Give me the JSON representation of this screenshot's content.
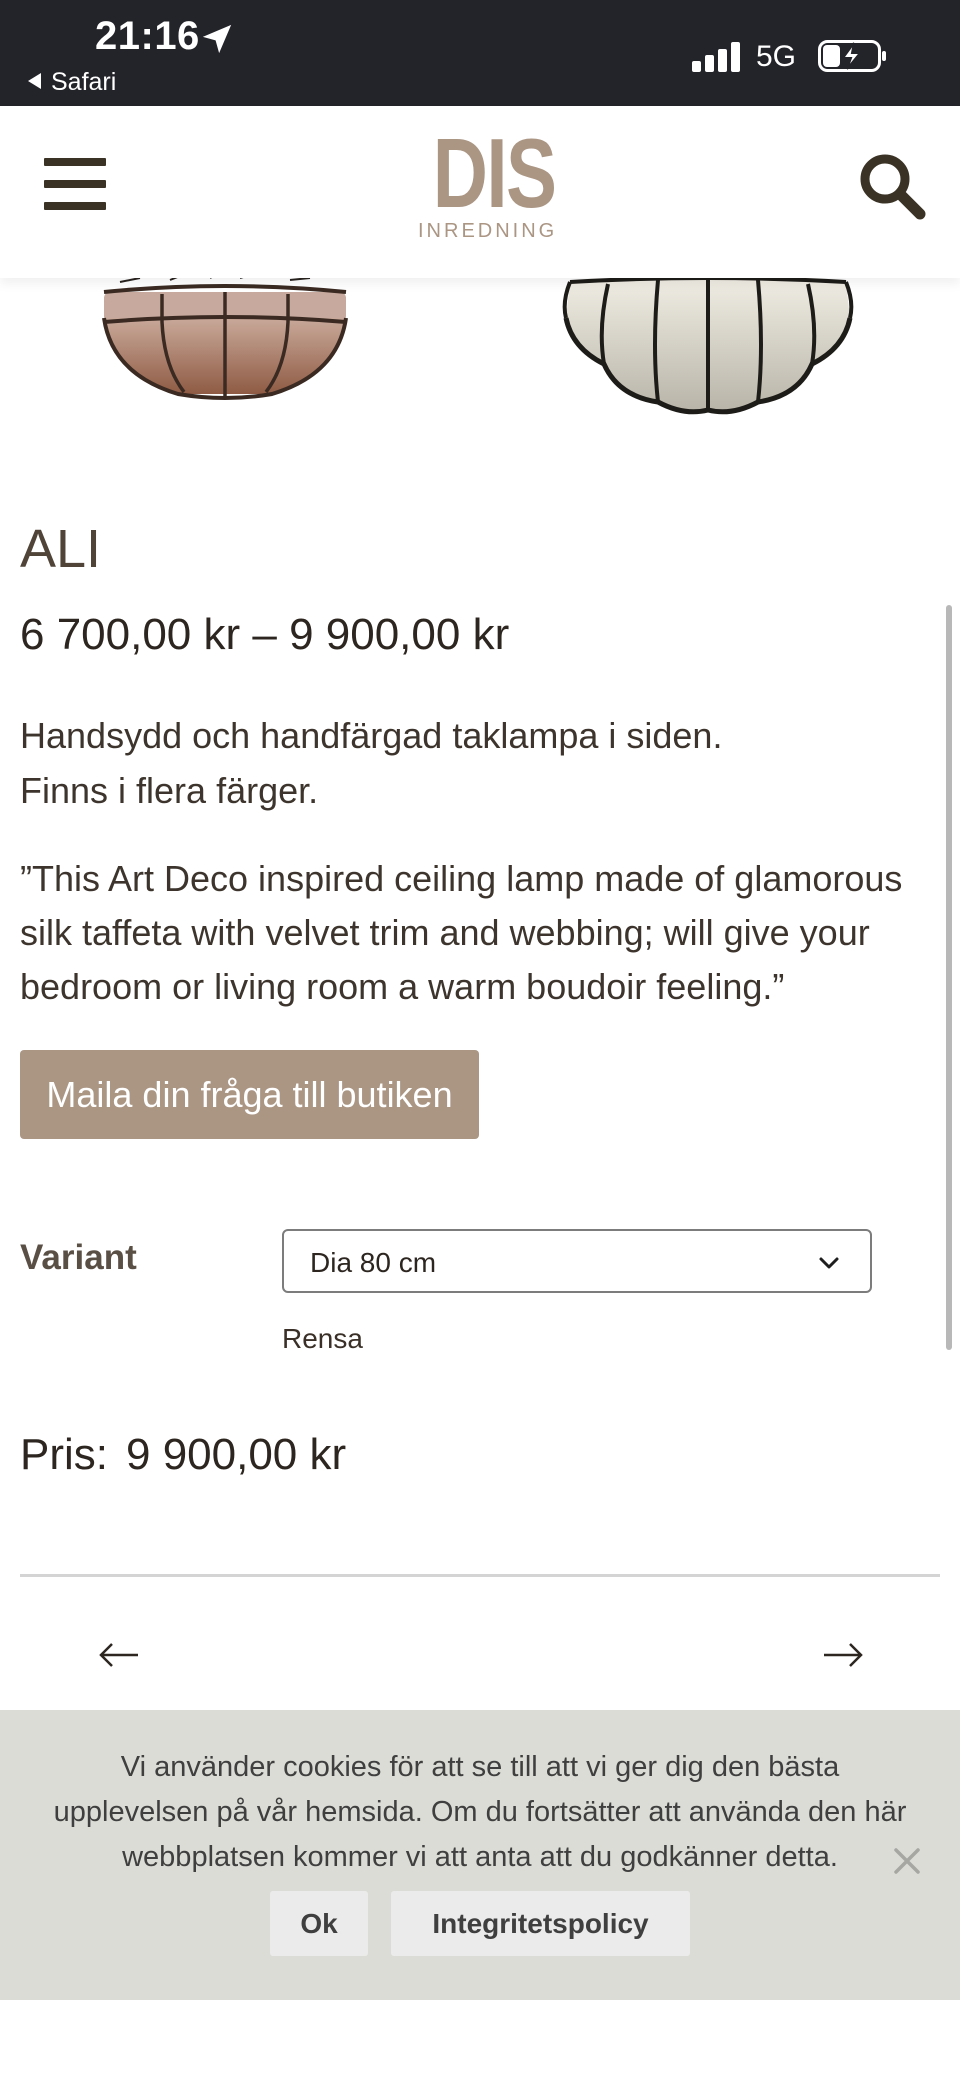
{
  "status_bar": {
    "time": "21:16",
    "back_app": "Safari",
    "network": "5G"
  },
  "header": {
    "logo_main": "DIS",
    "logo_sub": "INREDNING",
    "brand_color": "#ab9684"
  },
  "product": {
    "title": "ALI",
    "price_range": "6 700,00 kr – 9 900,00 kr",
    "short_desc_line1": "Handsydd och handfärgad taklampa i siden.",
    "short_desc_line2": "Finns i flera färger.",
    "long_desc": "”This Art Deco inspired ceiling lamp made of glamorous silk taffeta with velvet trim and webbing; will give your bedroom or living room a warm boudoir feeling.”",
    "email_button": "Maila din fråga till butiken",
    "variant_label": "Variant",
    "variant_selected": "Dia 80 cm",
    "clear_link": "Rensa",
    "price_label": "Pris:",
    "price_value": "9 900,00 kr"
  },
  "nav": {
    "prev": "←",
    "next": "→"
  },
  "cookie": {
    "text": "Vi använder cookies för att se till att vi ger dig den bästa upplevelsen på vår hemsida. Om du fortsätter att använda den här webbplatsen kommer vi att anta att du godkänner detta.",
    "ok": "Ok",
    "policy": "Integritetspolicy"
  },
  "icons": {
    "menu": "hamburger-menu-icon",
    "search": "search-icon",
    "dropdown": "chevron-down-icon",
    "close": "close-icon"
  }
}
